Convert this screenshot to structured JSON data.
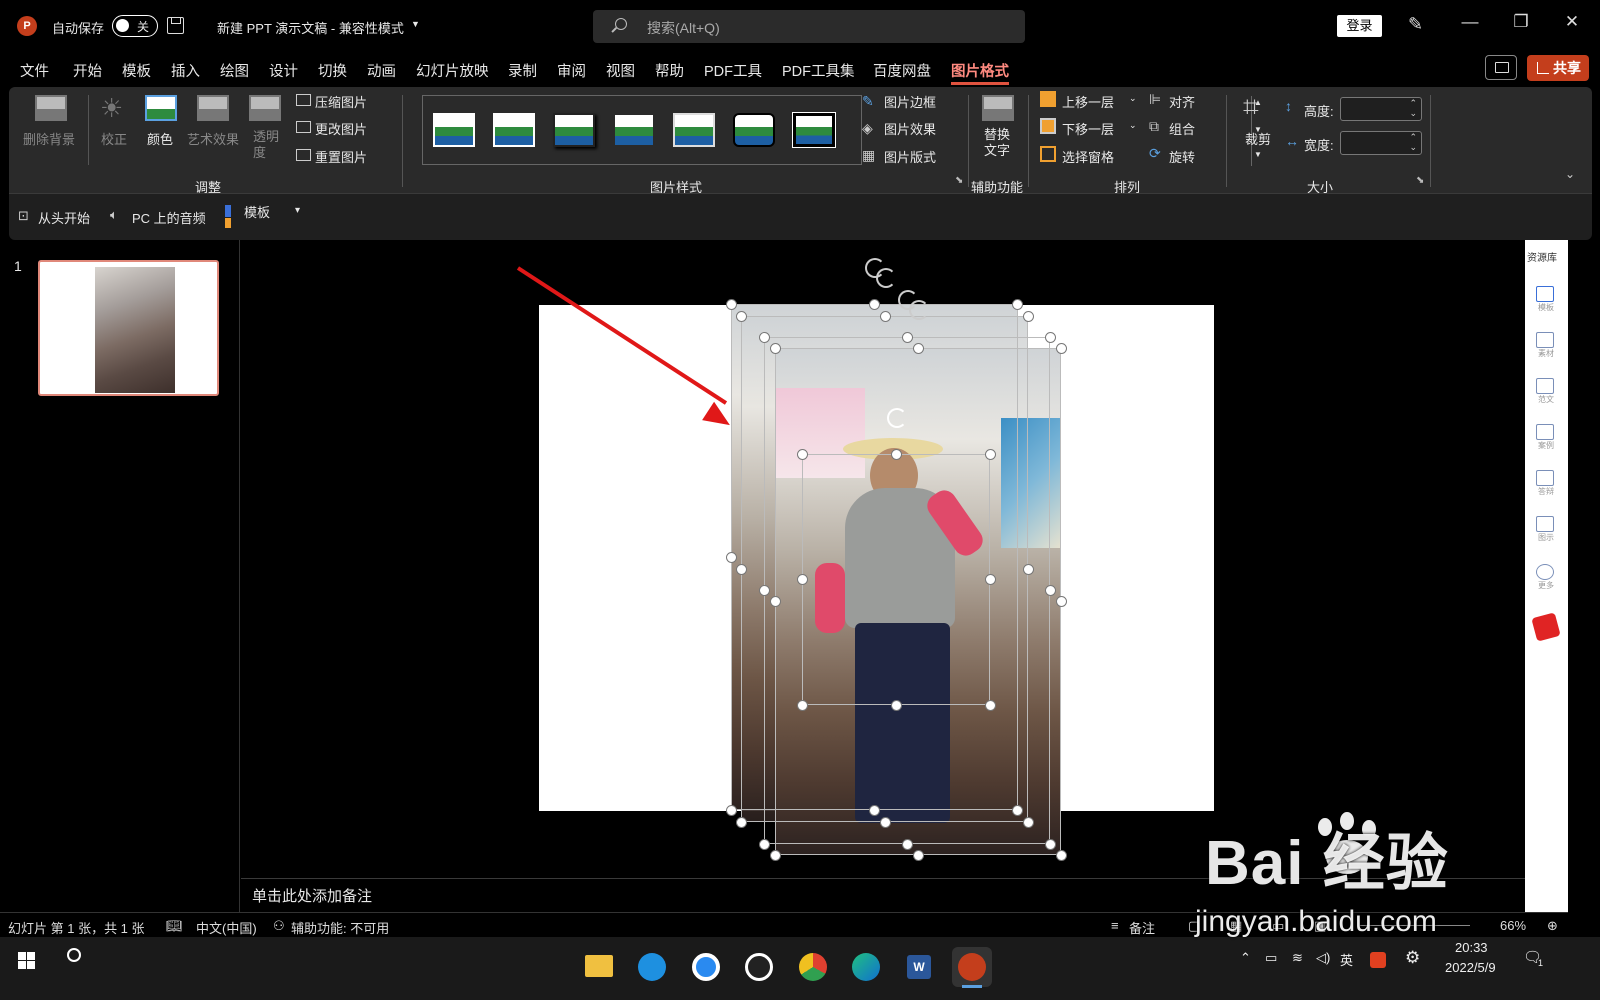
{
  "titlebar": {
    "app_icon": "P",
    "autosave_label": "自动保存",
    "autosave_state": "关",
    "doc_title": "新建 PPT 演示文稿  -  兼容性模式",
    "search_placeholder": "搜索(Alt+Q)",
    "login_label": "登录",
    "minimize": "—",
    "restore": "❐",
    "close": "✕"
  },
  "menu": {
    "items": [
      "文件",
      "开始",
      "模板",
      "插入",
      "绘图",
      "设计",
      "切换",
      "动画",
      "幻灯片放映",
      "录制",
      "审阅",
      "视图",
      "帮助",
      "PDF工具",
      "PDF工具集",
      "百度网盘",
      "图片格式"
    ],
    "active": "图片格式",
    "share_label": "共享"
  },
  "ribbon": {
    "adjust": {
      "group_label": "调整",
      "remove_bg": "删除背景",
      "correct": "校正",
      "color": "颜色",
      "art_effects": "艺术效果",
      "transparency": "透明\n度",
      "compress": "压缩图片",
      "change": "更改图片",
      "reset": "重置图片"
    },
    "styles": {
      "group_label": "图片样式",
      "border": "图片边框",
      "effects": "图片效果",
      "layout": "图片版式"
    },
    "accessibility": {
      "group_label": "辅助功能",
      "alt_text": "替换\n文字"
    },
    "arrange": {
      "group_label": "排列",
      "bring_forward": "上移一层",
      "send_backward": "下移一层",
      "selection_pane": "选择窗格",
      "align": "对齐",
      "group": "组合",
      "rotate": "旋转"
    },
    "size": {
      "group_label": "大小",
      "crop": "裁剪",
      "height_label": "高度:",
      "width_label": "宽度:",
      "height_value": "",
      "width_value": ""
    }
  },
  "qat": {
    "from_start": "从头开始",
    "pc_audio": "PC 上的音频",
    "template": "模板"
  },
  "thumbs": {
    "slide_number": "1"
  },
  "notes": {
    "placeholder": "单击此处添加备注"
  },
  "right_panel": {
    "title": "资源库",
    "items": [
      "模板",
      "素材",
      "范文",
      "案例",
      "答辩",
      "图示",
      "更多"
    ]
  },
  "status": {
    "slide_info": "幻灯片 第 1 张，共 1 张",
    "language": "中文(中国)",
    "accessibility": "辅助功能: 不可用",
    "notes_btn": "备注",
    "zoom": "66%"
  },
  "taskbar": {
    "ime": "英",
    "time": "20:33",
    "date": "2022/5/9",
    "notify_count": "1"
  },
  "watermark": {
    "brand": "Bai  经验",
    "url": "jingyan.baidu.com"
  },
  "colors": {
    "accent": "#c43e1c",
    "active_tab": "#ff8a80",
    "ribbon_bg": "#2a2a2a",
    "annotation_arrow": "#e01818"
  }
}
